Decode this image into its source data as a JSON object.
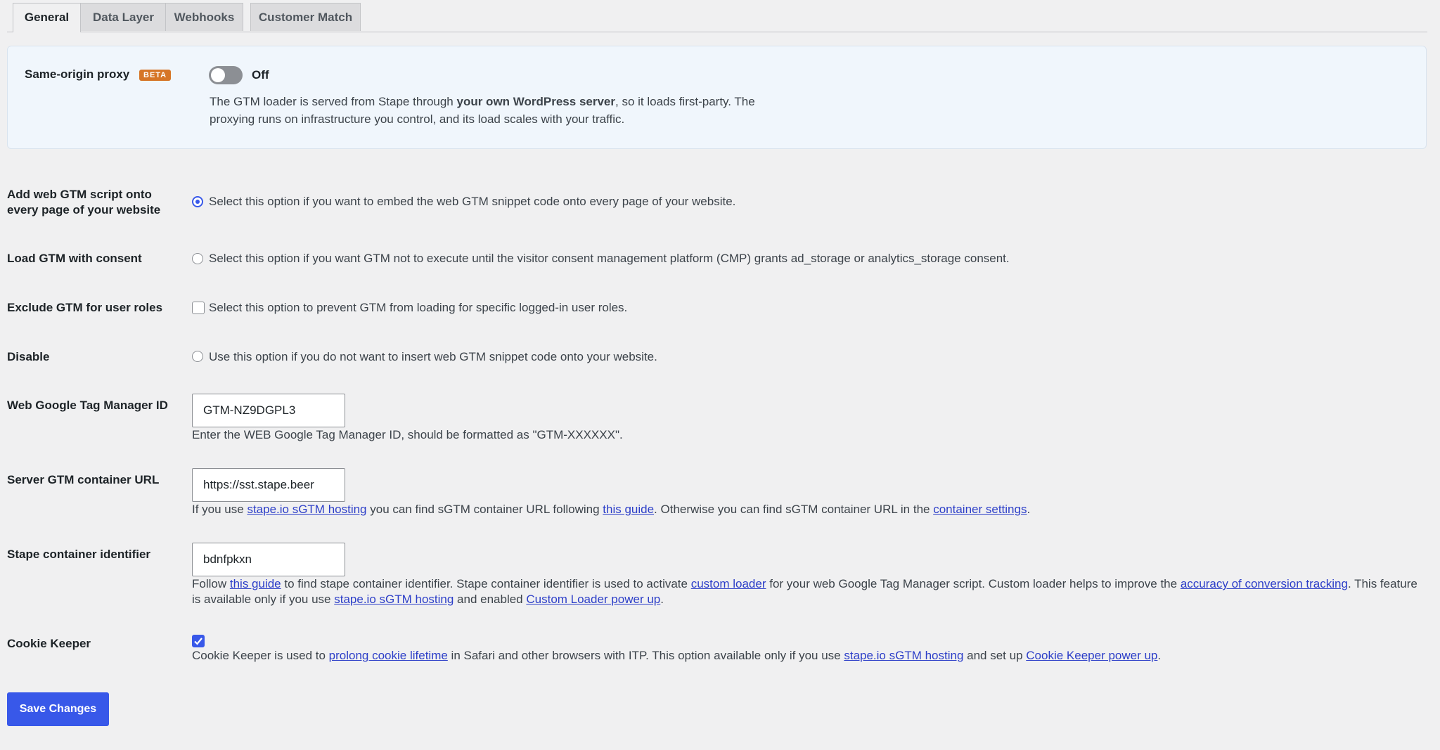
{
  "tabs": [
    {
      "label": "General",
      "active": true
    },
    {
      "label": "Data Layer",
      "active": false
    },
    {
      "label": "Webhooks",
      "active": false
    },
    {
      "label": "Customer Match",
      "active": false
    }
  ],
  "proxy": {
    "label": "Same-origin proxy",
    "badge": "BETA",
    "toggle_state": "Off",
    "desc_1": "The GTM loader is served from Stape through ",
    "desc_bold": "your own WordPress server",
    "desc_2": ", so it loads first-party. The proxying runs on infrastructure you control, and its load scales with your traffic."
  },
  "options": {
    "add_script": {
      "label": "Add web GTM script onto every page of your website",
      "text": "Select this option if you want to embed the web GTM snippet code onto every page of your website.",
      "selected": true
    },
    "consent": {
      "label": "Load GTM with consent",
      "text": "Select this option if you want GTM not to execute until the visitor consent management platform (CMP) grants ad_storage or analytics_storage consent.",
      "selected": false
    },
    "exclude_roles": {
      "label": "Exclude GTM for user roles",
      "text": "Select this option to prevent GTM from loading for specific logged-in user roles.",
      "checked": false
    },
    "disable": {
      "label": "Disable",
      "text": "Use this option if you do not want to insert web GTM snippet code onto your website.",
      "selected": false
    }
  },
  "gtm_id": {
    "label": "Web Google Tag Manager ID",
    "value": "GTM-NZ9DGPL3",
    "help": "Enter the WEB Google Tag Manager ID, should be formatted as \"GTM-XXXXXX\"."
  },
  "server_url": {
    "label": "Server GTM container URL",
    "value": "https://sst.stape.beer",
    "help_1": "If you use ",
    "link_1": "stape.io sGTM hosting",
    "help_2": " you can find sGTM container URL following ",
    "link_2": "this guide",
    "help_3": ". Otherwise you can find sGTM container URL in the ",
    "link_3": "container settings",
    "help_4": "."
  },
  "stape_id": {
    "label": "Stape container identifier",
    "value": "bdnfpkxn",
    "help_1": "Follow ",
    "link_1": "this guide",
    "help_2": " to find stape container identifier. Stape container identifier is used to activate ",
    "link_2": "custom loader",
    "help_3": " for your web Google Tag Manager script. Custom loader helps to improve the ",
    "link_3": "accuracy of conversion tracking",
    "help_4": ". This feature is available only if you use ",
    "link_4": "stape.io sGTM hosting",
    "help_5": " and enabled ",
    "link_5": "Custom Loader power up",
    "help_6": "."
  },
  "cookie_keeper": {
    "label": "Cookie Keeper",
    "checked": true,
    "help_1": "Cookie Keeper is used to ",
    "link_1": "prolong cookie lifetime",
    "help_2": " in Safari and other browsers with ITP. This option available only if you use ",
    "link_2": "stape.io sGTM hosting",
    "help_3": " and set up ",
    "link_3": "Cookie Keeper power up",
    "help_4": "."
  },
  "save_label": "Save Changes",
  "colors": {
    "accent": "#3858e9",
    "badge": "#d67527",
    "link": "#2c3ec8"
  }
}
